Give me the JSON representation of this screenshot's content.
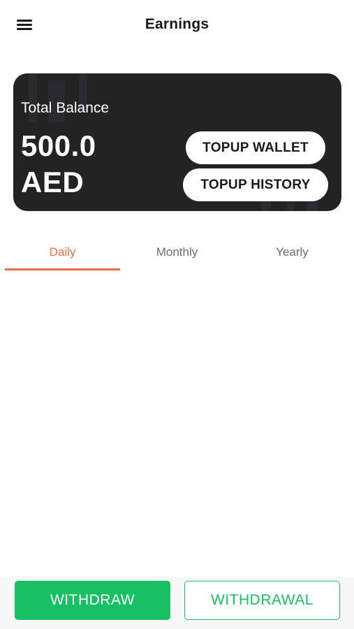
{
  "header": {
    "title": "Earnings",
    "menu_icon": "hamburger-menu-icon"
  },
  "balance_card": {
    "label": "Total Balance",
    "amount": "500.0",
    "currency": "AED",
    "topup_wallet_label": "TOPUP WALLET",
    "topup_history_label": "TOPUP HISTORY",
    "background_color": "#232323"
  },
  "tabs": {
    "items": [
      {
        "label": "Daily",
        "active": true
      },
      {
        "label": "Monthly",
        "active": false
      },
      {
        "label": "Yearly",
        "active": false
      }
    ],
    "active_color": "#ef6b4a"
  },
  "bottom_bar": {
    "withdraw_label": "WITHDRAW",
    "withdrawal_label": "WITHDRAWAL",
    "accent_color": "#16c063"
  }
}
